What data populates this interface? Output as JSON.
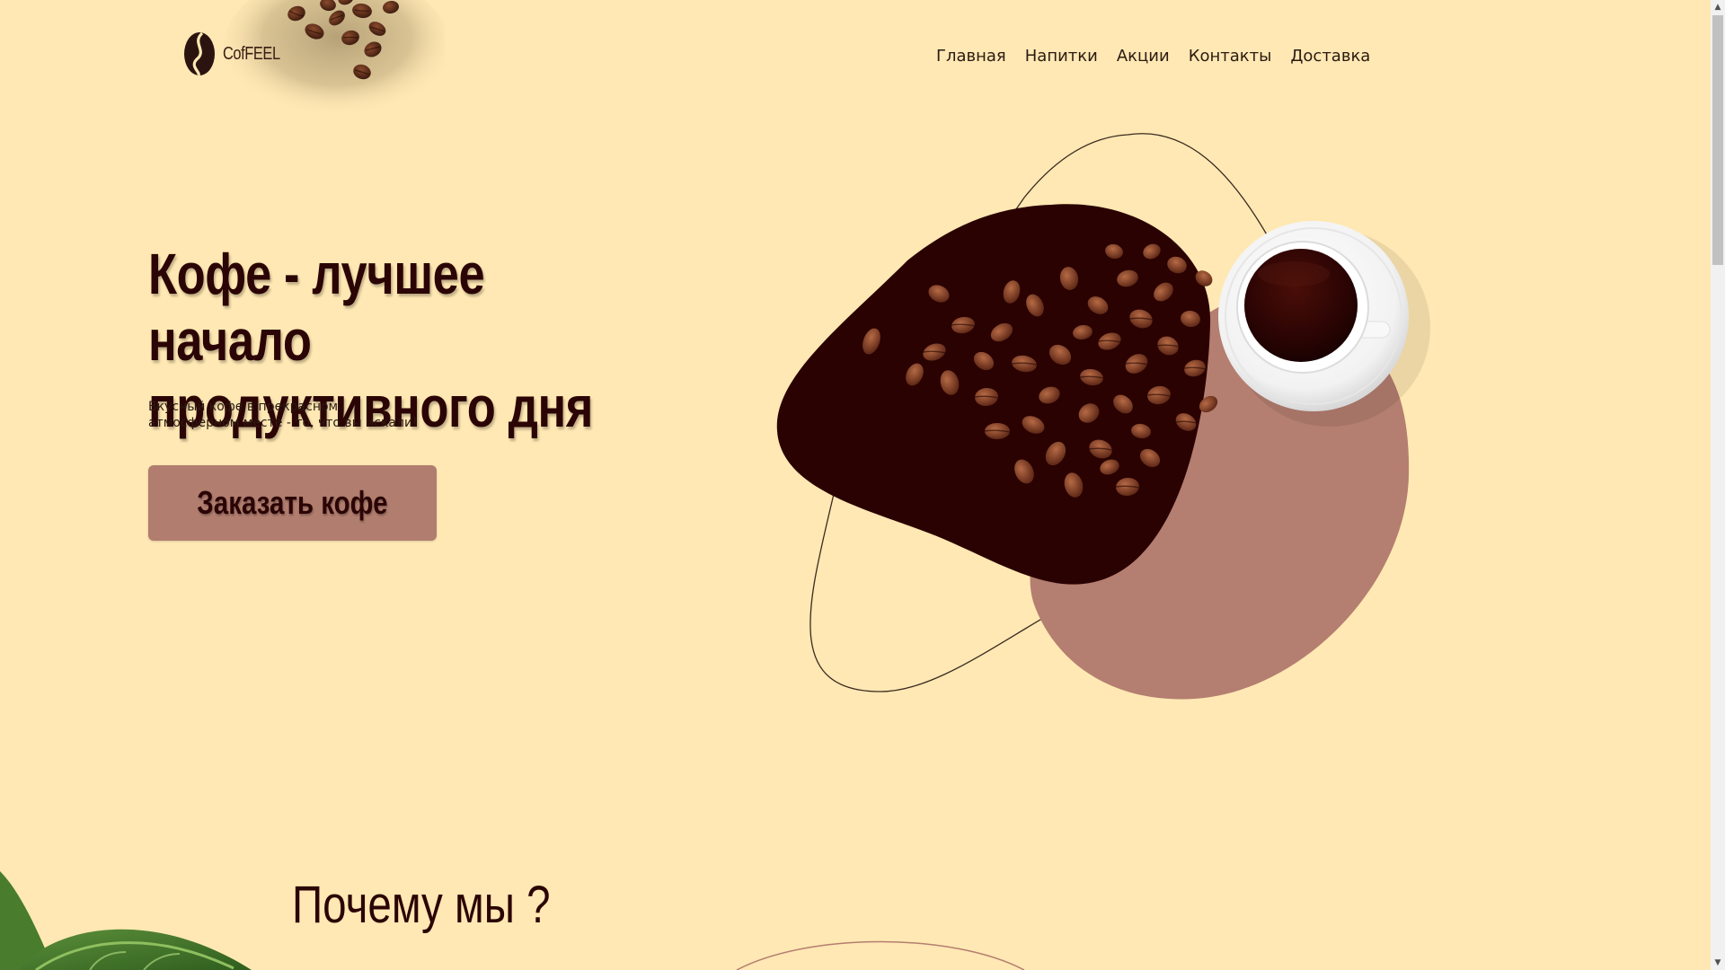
{
  "header": {
    "logo_text": "CofFEEL",
    "nav": [
      {
        "label": "Главная"
      },
      {
        "label": "Напитки"
      },
      {
        "label": "Акции"
      },
      {
        "label": "Контакты"
      },
      {
        "label": "Доставка"
      }
    ]
  },
  "hero": {
    "title": "Кофе - лучшее начало продуктивного дня",
    "subtitle": "Вкусный кофе в прекрасном атмосферном месте - то, что вы искали!",
    "order_button": "Заказать кофе"
  },
  "why_section": {
    "title": "Почему мы ?"
  },
  "scrollbar": {
    "up_glyph": "▲",
    "down_glyph": "▼"
  },
  "colors": {
    "background": "#ffe8b3",
    "dark_brown": "#2a0202",
    "accent": "#b07d6e",
    "button_text": "#2b0505"
  },
  "icons": {
    "logo": "coffee-bean-logo-icon",
    "art": "coffee-beans-and-cup-illustration"
  }
}
